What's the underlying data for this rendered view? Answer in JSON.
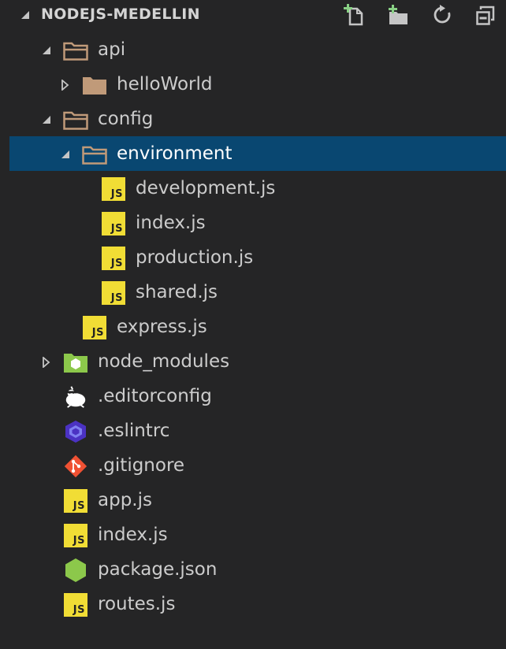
{
  "explorer": {
    "title": "NODEJS-MEDELLIN",
    "actions": [
      {
        "name": "new-file-icon"
      },
      {
        "name": "new-folder-icon"
      },
      {
        "name": "refresh-icon"
      },
      {
        "name": "collapse-all-icon"
      }
    ],
    "tree": [
      {
        "label": "api",
        "type": "folder",
        "depth": 1,
        "expanded": true
      },
      {
        "label": "helloWorld",
        "type": "folder",
        "depth": 2,
        "expanded": false
      },
      {
        "label": "config",
        "type": "folder",
        "depth": 1,
        "expanded": true
      },
      {
        "label": "environment",
        "type": "folder",
        "depth": 2,
        "expanded": true,
        "selected": true
      },
      {
        "label": "development.js",
        "type": "js",
        "depth": 3
      },
      {
        "label": "index.js",
        "type": "js",
        "depth": 3
      },
      {
        "label": "production.js",
        "type": "js",
        "depth": 3
      },
      {
        "label": "shared.js",
        "type": "js",
        "depth": 3
      },
      {
        "label": "express.js",
        "type": "js",
        "depth": 2
      },
      {
        "label": "node_modules",
        "type": "node",
        "depth": 1,
        "expanded": false
      },
      {
        "label": ".editorconfig",
        "type": "editorconfig",
        "depth": 1
      },
      {
        "label": ".eslintrc",
        "type": "eslint",
        "depth": 1
      },
      {
        "label": ".gitignore",
        "type": "git",
        "depth": 1
      },
      {
        "label": "app.js",
        "type": "js",
        "depth": 1
      },
      {
        "label": "index.js",
        "type": "js",
        "depth": 1
      },
      {
        "label": "package.json",
        "type": "npm",
        "depth": 1
      },
      {
        "label": "routes.js",
        "type": "js",
        "depth": 1
      }
    ]
  },
  "colors": {
    "background": "#252526",
    "selected": "#094771",
    "js_badge": "#f1dd35",
    "folder": "#c09a79",
    "node_green": "#8cc84b",
    "eslint_purple": "#4b32c3",
    "git_orange": "#f05133"
  }
}
